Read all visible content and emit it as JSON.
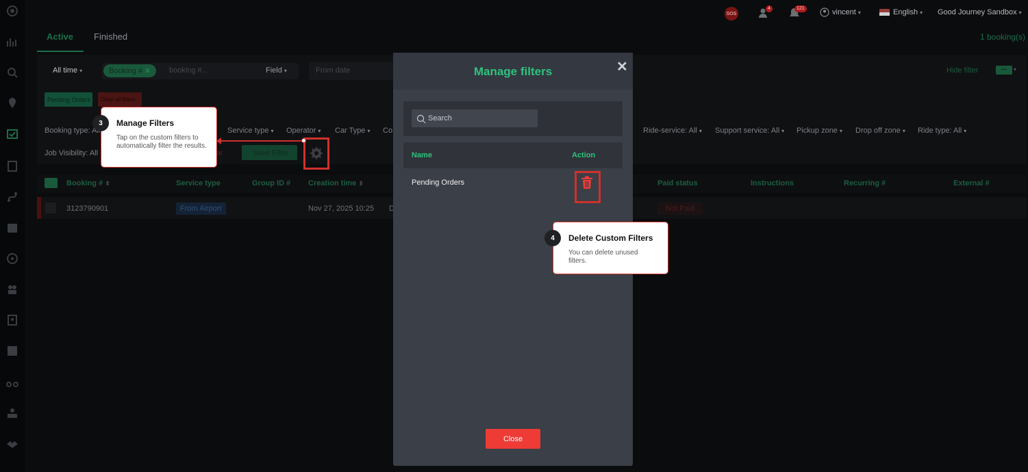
{
  "topbar": {
    "sos": "SOS",
    "users_badge": "4",
    "notif_badge": "121",
    "user": "vincent",
    "language": "English",
    "company": "Good Journey Sandbox",
    "bookings_count": "1 booking(s)"
  },
  "tabs": {
    "active": "Active",
    "finished": "Finished"
  },
  "filters": {
    "time": "All time",
    "chip_booking": "Booking #",
    "booking_placeholder": "booking #...",
    "field": "Field",
    "from_date": "From date",
    "hide_filter": "Hide filter",
    "saved_chip": "Pending Orders",
    "clear_all": "Clear all filters",
    "booking_type": "Booking type: All",
    "service_type": "Service type",
    "operator": "Operator",
    "car_type": "Car Type",
    "co": "Co",
    "ride_service": "Ride-service: All",
    "support_service": "Support service: All",
    "pickup_zone": "Pickup zone",
    "dropoff_zone": "Drop off zone",
    "ride_type": "Ride type: All",
    "job_visibility": "Job Visibility: All",
    "clear": "ar",
    "save_filter": "Save Filter"
  },
  "table": {
    "headers": {
      "booking": "Booking #",
      "service_type": "Service type",
      "group_id": "Group ID #",
      "creation_time": "Creation time",
      "paid_status": "Paid status",
      "instructions": "Instructions",
      "recurring": "Recurring #",
      "external": "External #"
    },
    "row": {
      "booking": "3123790901",
      "service_type": "From Airport",
      "creation_time": "Nov 27, 2025 10:25",
      "d": "D",
      "paid_status": "Not Paid"
    }
  },
  "modal": {
    "title": "Manage filters",
    "close_x": "✕",
    "search_placeholder": "Search",
    "col_name": "Name",
    "col_action": "Action",
    "filter_name": "Pending Orders",
    "close_button": "Close"
  },
  "callouts": {
    "c3": {
      "num": "3",
      "title": "Manage Filters",
      "body": "Tap on the custom filters to automatically filter the results."
    },
    "c4": {
      "num": "4",
      "title": "Delete Custom Filters",
      "body": "You can delete unused filters."
    }
  },
  "colors": {
    "accent": "#2ec27e",
    "danger": "#ee3b36",
    "highlight": "#d0312d"
  }
}
